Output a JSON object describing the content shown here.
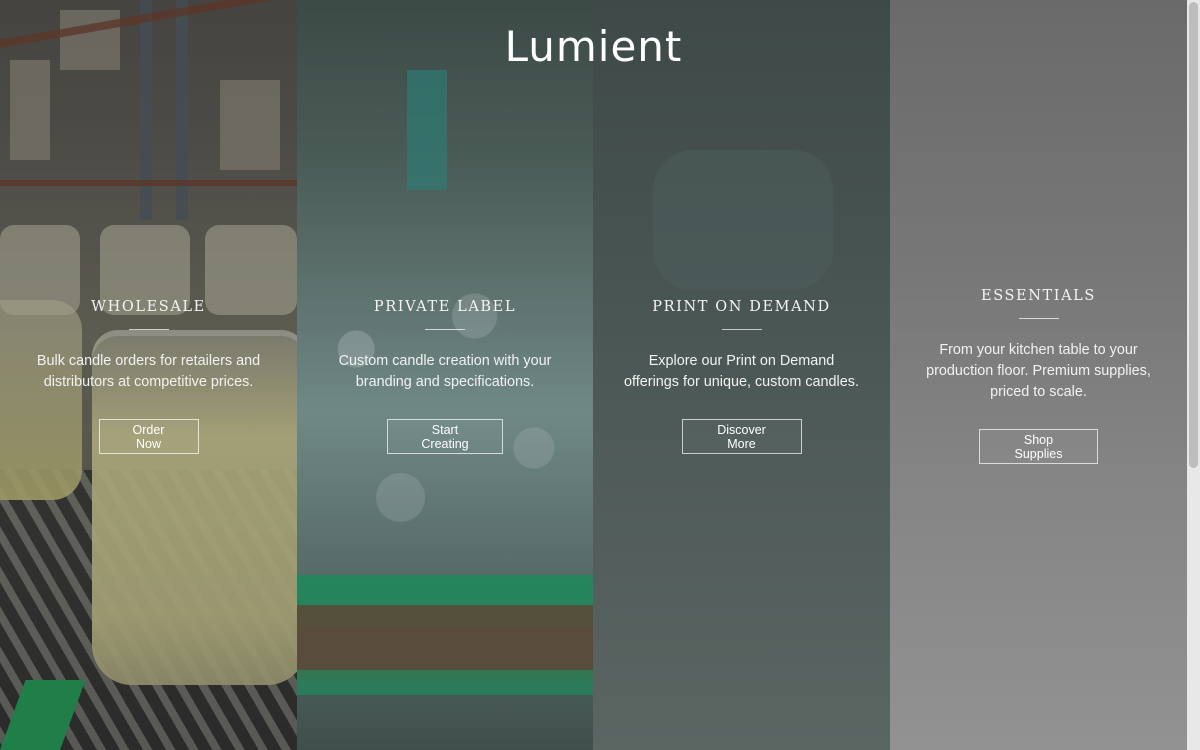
{
  "brand": {
    "logo_text": "Lumient"
  },
  "panels": [
    {
      "heading": "WHOLESALE",
      "description": "Bulk candle orders for retailers and distributors at competitive prices.",
      "button": "Order Now"
    },
    {
      "heading": "PRIVATE LABEL",
      "description": "Custom candle creation with your branding and specifications.",
      "button": "Start Creating"
    },
    {
      "heading": "PRINT ON DEMAND",
      "description": "Explore our Print on Demand offerings for unique, custom candles.",
      "button": "Discover More"
    },
    {
      "heading": "ESSENTIALS",
      "description": "From your kitchen table to your production floor. Premium supplies, priced to scale.",
      "button": "Shop Supplies"
    }
  ],
  "colors": {
    "panel_text": "#ffffff",
    "panel4_bg": "#7f7f7f",
    "accent_green": "#1f8a5c"
  }
}
